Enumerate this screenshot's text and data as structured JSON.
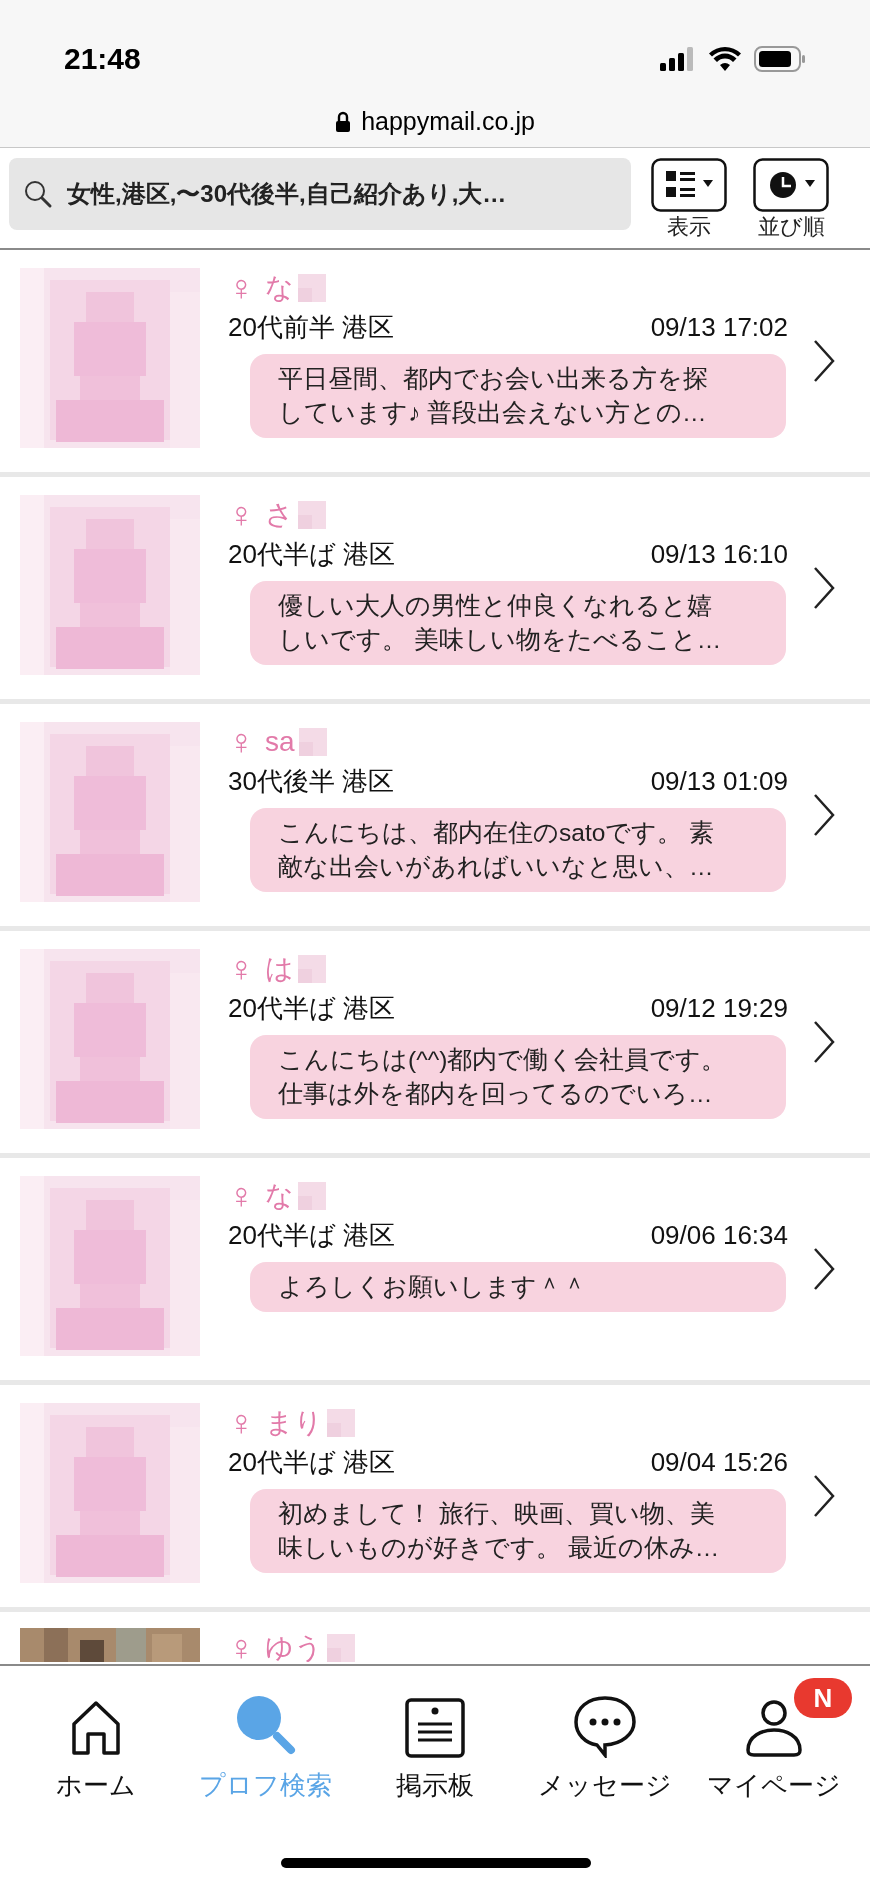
{
  "status_bar": {
    "time": "21:48"
  },
  "address_bar": {
    "url": "happymail.co.jp"
  },
  "search": {
    "value": "女性,港区,〜30代後半,自己紹介あり,大…"
  },
  "toolbar": [
    {
      "label": "表示",
      "kind": "view"
    },
    {
      "label": "並び順",
      "kind": "sort"
    }
  ],
  "profiles": [
    {
      "gender": "♀",
      "name": "な",
      "age_area": "20代前半 港区",
      "time": "09/13 17:02",
      "message_lines": [
        "平日昼間、都内でお会い出来る方を探",
        "しています♪ 普段出会えない方との…"
      ],
      "avatar": {
        "kind": "silhouette"
      }
    },
    {
      "gender": "♀",
      "name": "さ",
      "age_area": "20代半ば 港区",
      "time": "09/13 16:10",
      "message_lines": [
        "優しい大人の男性と仲良くなれると嬉",
        "しいです。 美味しい物をたべること…"
      ],
      "avatar": {
        "kind": "silhouette"
      }
    },
    {
      "gender": "♀",
      "name": "sa",
      "age_area": "30代後半 港区",
      "time": "09/13 01:09",
      "message_lines": [
        "こんにちは、都内在住のsatoです。 素",
        "敵な出会いがあればいいなと思い、…"
      ],
      "avatar": {
        "kind": "silhouette"
      }
    },
    {
      "gender": "♀",
      "name": "は",
      "age_area": "20代半ば 港区",
      "time": "09/12 19:29",
      "message_lines": [
        "こんにちは(^^)都内で働く会社員です。",
        "仕事は外を都内を回ってるのでいろ…"
      ],
      "avatar": {
        "kind": "silhouette"
      }
    },
    {
      "gender": "♀",
      "name": "な",
      "age_area": "20代半ば 港区",
      "time": "09/06 16:34",
      "message_lines": [
        "よろしくお願いします＾＾"
      ],
      "avatar": {
        "kind": "silhouette"
      }
    },
    {
      "gender": "♀",
      "name": "まり",
      "age_area": "20代半ば 港区",
      "time": "09/04 15:26",
      "message_lines": [
        "初めまして！ 旅行、映画、買い物、美",
        "味しいものが好きです。 最近の休み…"
      ],
      "avatar": {
        "kind": "silhouette"
      }
    },
    {
      "gender": "♀",
      "name": "ゆう"
    }
  ],
  "tab_bar": [
    {
      "label": "ホーム",
      "kind": "home",
      "selected": false
    },
    {
      "label": "プロフ検索",
      "kind": "search",
      "selected": true
    },
    {
      "label": "掲示板",
      "kind": "board",
      "selected": false
    },
    {
      "label": "メッセージ",
      "kind": "message",
      "selected": false
    },
    {
      "label": "マイページ",
      "kind": "mypage",
      "selected": false,
      "badge": "N"
    }
  ]
}
